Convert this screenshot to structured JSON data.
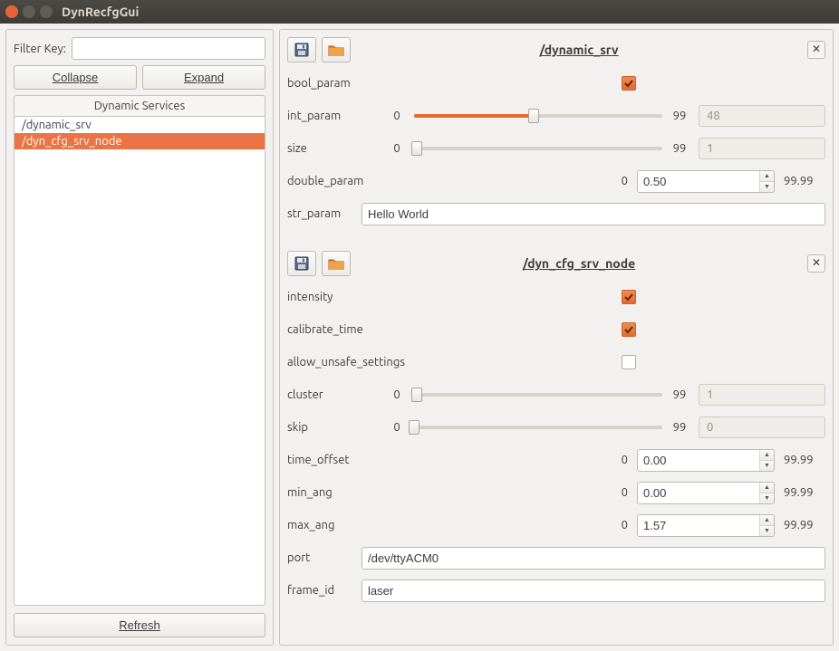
{
  "window": {
    "title": "DynRecfgGui"
  },
  "left": {
    "filter_label": "Filter Key:",
    "filter_value": "",
    "collapse": "Collapse",
    "expand": "Expand",
    "list_header": "Dynamic Services",
    "items": [
      {
        "label": "/dynamic_srv",
        "selected": false
      },
      {
        "label": "/dyn_cfg_srv_node",
        "selected": true
      }
    ],
    "refresh": "Refresh"
  },
  "sections": [
    {
      "title": "/dynamic_srv",
      "params": [
        {
          "kind": "bool",
          "name": "bool_param",
          "checked": true
        },
        {
          "kind": "int_slider",
          "name": "int_param",
          "min": "0",
          "max": "99",
          "value_pct": 48,
          "locked": "48"
        },
        {
          "kind": "int_slider",
          "name": "size",
          "min": "0",
          "max": "99",
          "value_pct": 1,
          "locked": "1"
        },
        {
          "kind": "double",
          "name": "double_param",
          "min": "0",
          "value": "0.50",
          "max": "99.99"
        },
        {
          "kind": "string",
          "name": "str_param",
          "value": "Hello World"
        }
      ]
    },
    {
      "title": "/dyn_cfg_srv_node",
      "params": [
        {
          "kind": "bool",
          "name": "intensity",
          "checked": true
        },
        {
          "kind": "bool",
          "name": "calibrate_time",
          "checked": true
        },
        {
          "kind": "bool",
          "name": "allow_unsafe_settings",
          "checked": false
        },
        {
          "kind": "int_slider",
          "name": "cluster",
          "min": "0",
          "max": "99",
          "value_pct": 1,
          "locked": "1"
        },
        {
          "kind": "int_slider",
          "name": "skip",
          "min": "0",
          "max": "99",
          "value_pct": 0,
          "locked": "0"
        },
        {
          "kind": "double",
          "name": "time_offset",
          "min": "0",
          "value": "0.00",
          "max": "99.99"
        },
        {
          "kind": "double",
          "name": "min_ang",
          "min": "0",
          "value": "0.00",
          "max": "99.99"
        },
        {
          "kind": "double",
          "name": "max_ang",
          "min": "0",
          "value": "1.57",
          "max": "99.99"
        },
        {
          "kind": "string",
          "name": "port",
          "value": "/dev/ttyACM0"
        },
        {
          "kind": "string",
          "name": "frame_id",
          "value": "laser"
        }
      ]
    }
  ]
}
